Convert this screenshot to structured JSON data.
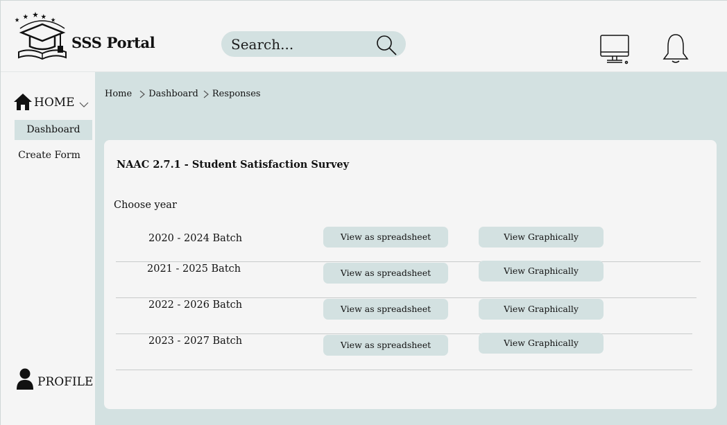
{
  "header": {
    "brand": "SSS Portal",
    "search_placeholder": "Search..."
  },
  "sidebar": {
    "home_label": "HOME",
    "items": [
      {
        "label": "Dashboard",
        "active": true
      },
      {
        "label": "Create Form",
        "active": false
      }
    ],
    "profile_label": "PROFILE"
  },
  "breadcrumb": [
    "Home",
    "Dashboard",
    "Responses"
  ],
  "survey": {
    "title": "NAAC 2.7.1 - Student Satisfaction Survey",
    "choose_label": "Choose year",
    "rows": [
      {
        "batch": "2020 - 2024 Batch",
        "spreadsheet_label": "View as spreadsheet",
        "graph_label": "View Graphically"
      },
      {
        "batch": "2021 - 2025 Batch",
        "spreadsheet_label": "View as spreadsheet",
        "graph_label": "View Graphically"
      },
      {
        "batch": "2022 - 2026 Batch",
        "spreadsheet_label": "View as spreadsheet",
        "graph_label": "View Graphically"
      },
      {
        "batch": "2023 - 2027 Batch",
        "spreadsheet_label": "View as spreadsheet",
        "graph_label": "View Graphically"
      }
    ]
  },
  "colors": {
    "accent": "#d3e1e1",
    "background": "#f5f5f5",
    "text": "#111111"
  },
  "icons": [
    "graduation-cap-logo-icon",
    "search-icon",
    "monitor-icon",
    "bell-icon",
    "home-icon",
    "chevron-down-icon",
    "chevron-right-icon",
    "user-icon"
  ]
}
